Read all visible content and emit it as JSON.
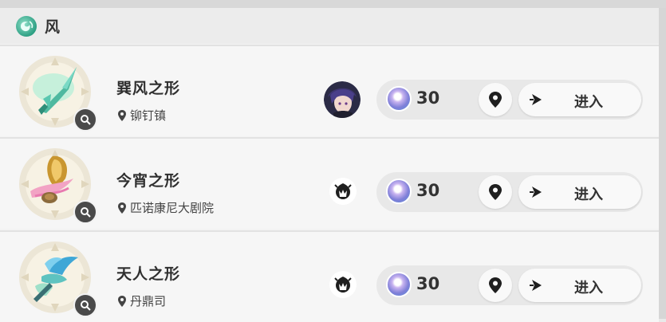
{
  "header": {
    "element_icon": "anemo-element-icon",
    "title": "风"
  },
  "rows": [
    {
      "name": "巽风之形",
      "location": "铆钉镇",
      "thumb_icon": "spear-relic-icon",
      "boss_icon": "character-portrait-icon",
      "resin_cost": "30",
      "enter_label": "进入"
    },
    {
      "name": "今宵之形",
      "location": "匹诺康尼大剧院",
      "thumb_icon": "golden-chalice-relic-icon",
      "boss_icon": "boss-silhouette-icon",
      "resin_cost": "30",
      "enter_label": "进入"
    },
    {
      "name": "天人之形",
      "location": "丹鼎司",
      "thumb_icon": "bird-relic-icon",
      "boss_icon": "boss-silhouette-icon",
      "resin_cost": "30",
      "enter_label": "进入"
    }
  ],
  "colors": {
    "anemo": "#2d9f83",
    "panel": "#f6f6f6",
    "action_bar": "#e8e8e8"
  }
}
